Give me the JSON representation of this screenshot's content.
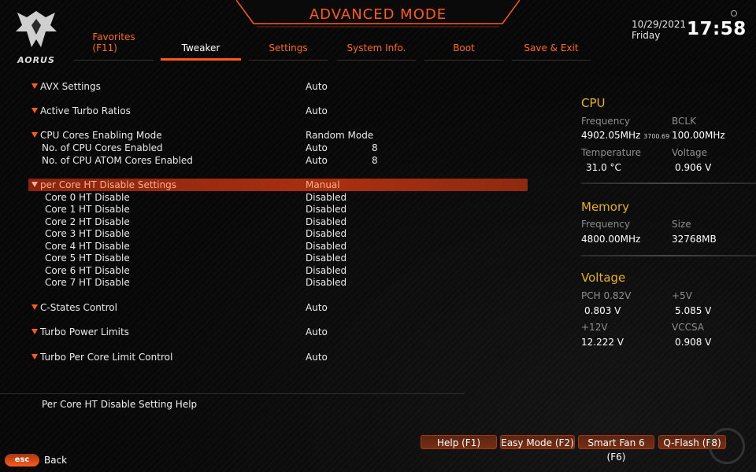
{
  "header": {
    "mode_title": "ADVANCED MODE",
    "logo_text": "AORUS",
    "date": "10/29/2021",
    "day": "Friday",
    "time": "17:58"
  },
  "tabs": [
    {
      "label": "Favorites",
      "label2": "(F11)"
    },
    {
      "label": "Tweaker",
      "active": true
    },
    {
      "label": "Settings"
    },
    {
      "label": "System Info."
    },
    {
      "label": "Boot"
    },
    {
      "label": "Save & Exit"
    }
  ],
  "settings": [
    {
      "label": "AVX Settings",
      "value": "Auto",
      "type": "group"
    },
    {
      "label": "Active Turbo Ratios",
      "value": "Auto",
      "type": "group"
    },
    {
      "label": "CPU Cores Enabling Mode",
      "value": "Random Mode",
      "type": "group"
    },
    {
      "label": "No. of CPU Cores Enabled",
      "value": "Auto",
      "num": "8",
      "type": "sub"
    },
    {
      "label": "No. of CPU ATOM Cores Enabled",
      "value": "Auto",
      "num": "8",
      "type": "sub"
    },
    {
      "label": "per Core HT Disable Settings",
      "value": "Manual",
      "type": "group",
      "selected": true
    },
    {
      "label": "Core 0 HT Disable",
      "value": "Disabled",
      "type": "sub2"
    },
    {
      "label": "Core 1 HT Disable",
      "value": "Disabled",
      "type": "sub2"
    },
    {
      "label": "Core 2 HT Disable",
      "value": "Disabled",
      "type": "sub2"
    },
    {
      "label": "Core 3 HT Disable",
      "value": "Disabled",
      "type": "sub2"
    },
    {
      "label": "Core 4 HT Disable",
      "value": "Disabled",
      "type": "sub2"
    },
    {
      "label": "Core 5 HT Disable",
      "value": "Disabled",
      "type": "sub2"
    },
    {
      "label": "Core 6 HT Disable",
      "value": "Disabled",
      "type": "sub2"
    },
    {
      "label": "Core 7 HT Disable",
      "value": "Disabled",
      "type": "sub2"
    },
    {
      "label": "C-States Control",
      "value": "Auto",
      "type": "group"
    },
    {
      "label": "Turbo Power Limits",
      "value": "Auto",
      "type": "group"
    },
    {
      "label": "Turbo Per Core Limit Control",
      "value": "Auto",
      "type": "group"
    }
  ],
  "panel": {
    "cpu": {
      "title": "CPU",
      "freq_label": "Frequency",
      "freq_value": "4902.05MHz",
      "freq_small": "3700.69",
      "bclk_label": "BCLK",
      "bclk_value": "100.00MHz",
      "temp_label": "Temperature",
      "temp_value": "31.0 °C",
      "volt_label": "Voltage",
      "volt_value": "0.906 V"
    },
    "memory": {
      "title": "Memory",
      "freq_label": "Frequency",
      "freq_value": "4800.00MHz",
      "size_label": "Size",
      "size_value": "32768MB"
    },
    "voltage": {
      "title": "Voltage",
      "pch_label": "PCH 0.82V",
      "pch_value": "0.803 V",
      "v5_label": "+5V",
      "v5_value": "5.085 V",
      "v12_label": "+12V",
      "v12_value": "12.222 V",
      "vccsa_label": "VCCSA",
      "vccsa_value": "0.908 V"
    }
  },
  "help_text": "Per Core HT Disable Setting Help",
  "footer": {
    "esc": "esc",
    "back": "Back",
    "buttons": [
      "Help (F1)",
      "Easy Mode (F2)",
      "Smart Fan 6 (F6)",
      "Q-Flash (F8)"
    ]
  },
  "colors": {
    "accent": "#ff5a1a",
    "section_title": "#e9b21a",
    "selected_row": "#a8300f"
  }
}
